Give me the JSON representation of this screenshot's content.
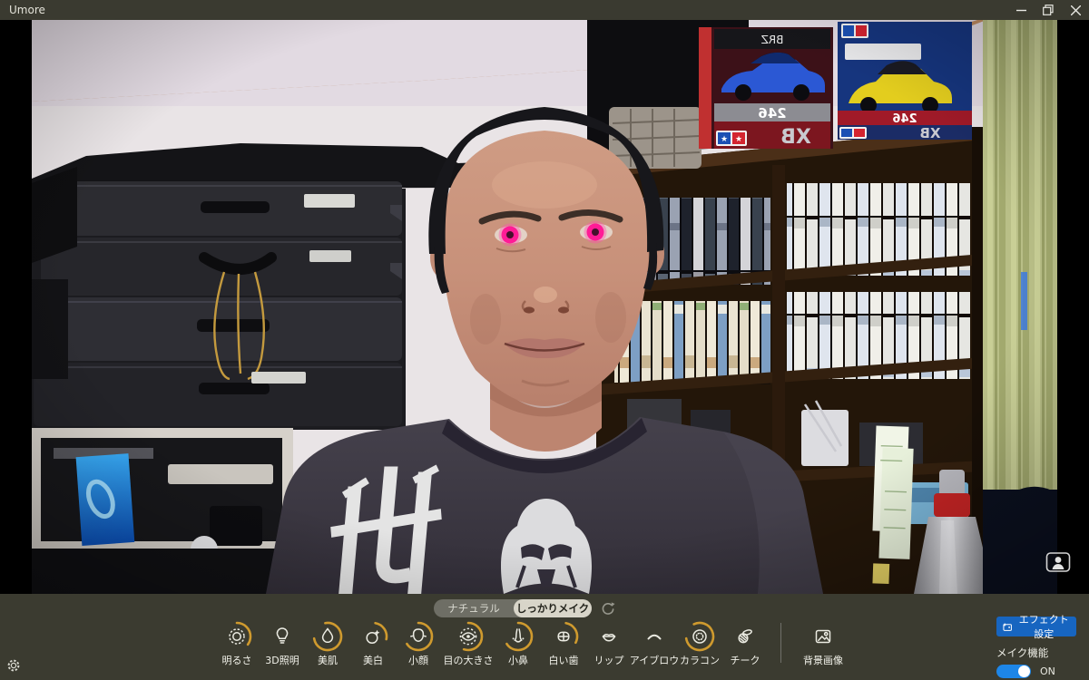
{
  "window": {
    "title": "Umore",
    "controls": {
      "minimize": "minimize",
      "restore": "restore",
      "close": "close"
    }
  },
  "colors": {
    "toolbar_bg": "#3b3b30",
    "titlebar_bg": "#3a3a30",
    "accent_blue": "#1765c0",
    "toggle_blue": "#1d86e8",
    "slider_arc_amber": "#cf9a2e",
    "contact_lens_pink": "#ff1b96",
    "selected_pill_bg": "#d8d5c9"
  },
  "presets": {
    "natural_label": "ナチュラル",
    "full_makeup_label": "しっかりメイク",
    "selected": "しっかりメイク",
    "reset_icon": "refresh-icon"
  },
  "filters": {
    "items": [
      {
        "label": "明るさ",
        "icon": "brightness-icon",
        "arc_dash": "33 95"
      },
      {
        "label": "3D照明",
        "icon": "bulb-icon",
        "arc_dash": "0 95"
      },
      {
        "label": "美肌",
        "icon": "droplet-icon",
        "arc_dash": "71 95"
      },
      {
        "label": "美白",
        "icon": "face-shine-icon",
        "arc_dash": "24 95"
      },
      {
        "label": "小顔",
        "icon": "small-face-icon",
        "arc_dash": "62 95"
      },
      {
        "label": "目の大きさ",
        "icon": "eye-icon",
        "arc_dash": "52 95"
      },
      {
        "label": "小鼻",
        "icon": "nose-icon",
        "arc_dash": "62 95"
      },
      {
        "label": "白い歯",
        "icon": "teeth-icon",
        "arc_dash": "28 95"
      },
      {
        "label": "リップ",
        "icon": "lips-icon",
        "arc_dash": "0 95"
      },
      {
        "label": "アイブロウ",
        "icon": "eyebrow-icon",
        "arc_dash": "0 95"
      },
      {
        "label": "カラコン",
        "icon": "contact-lens-icon",
        "arc_dash": "75 95"
      },
      {
        "label": "チーク",
        "icon": "cheek-icon",
        "arc_dash": "0 95"
      }
    ],
    "background_image_label": "背景画像"
  },
  "effects_panel": {
    "settings_button": "エフェクト設定",
    "makeup_feature_label": "メイク機能",
    "toggle_state": "ON"
  },
  "scene": {
    "car_model_text": "BRZ",
    "series_number_text": "246",
    "kit_type_text": "XB"
  }
}
